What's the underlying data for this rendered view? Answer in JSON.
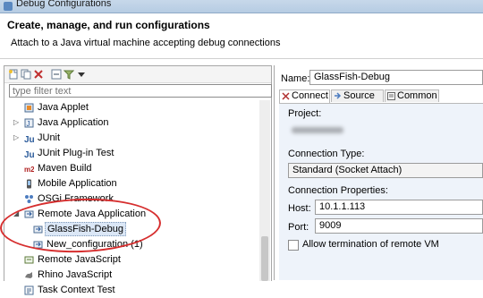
{
  "window": {
    "title": "Debug Configurations"
  },
  "header": {
    "title": "Create, manage, and run configurations",
    "subtitle": "Attach to a Java virtual machine accepting debug connections"
  },
  "left": {
    "filter_placeholder": "type filter text",
    "toolbar_icons": [
      "new-config-icon",
      "duplicate-icon",
      "delete-icon",
      "collapse-all-icon",
      "filter-icon",
      "dropdown-arrow-icon"
    ],
    "tree": [
      {
        "label": "Java Applet",
        "icon": "java-applet-icon",
        "level": 0,
        "expand": ""
      },
      {
        "label": "Java Application",
        "icon": "java-application-icon",
        "level": 0,
        "expand": "▷"
      },
      {
        "label": "JUnit",
        "icon": "junit-icon",
        "level": 0,
        "expand": "▷"
      },
      {
        "label": "JUnit Plug-in Test",
        "icon": "junit-plugin-icon",
        "level": 0,
        "expand": ""
      },
      {
        "label": "Maven Build",
        "icon": "maven-icon",
        "level": 0,
        "expand": ""
      },
      {
        "label": "Mobile Application",
        "icon": "mobile-icon",
        "level": 0,
        "expand": ""
      },
      {
        "label": "OSGi Framework",
        "icon": "osgi-icon",
        "level": 0,
        "expand": ""
      },
      {
        "label": "Remote Java Application",
        "icon": "remote-java-icon",
        "level": 0,
        "expand": "◢"
      },
      {
        "label": "GlassFish-Debug",
        "icon": "remote-java-icon",
        "level": 1,
        "expand": "",
        "selected": true
      },
      {
        "label": "New_configuration (1)",
        "icon": "remote-java-icon",
        "level": 1,
        "expand": ""
      },
      {
        "label": "Remote JavaScript",
        "icon": "remote-javascript-icon",
        "level": 0,
        "expand": ""
      },
      {
        "label": "Rhino JavaScript",
        "icon": "rhino-icon",
        "level": 0,
        "expand": ""
      },
      {
        "label": "Task Context Test",
        "icon": "task-context-icon",
        "level": 0,
        "expand": ""
      }
    ]
  },
  "right": {
    "name_label": "Name:",
    "name_value": "GlassFish-Debug",
    "tabs": [
      {
        "label": "Connect",
        "icon": "connect-icon",
        "active": true
      },
      {
        "label": "Source",
        "icon": "source-icon",
        "active": false
      },
      {
        "label": "Common",
        "icon": "common-icon",
        "active": false
      }
    ],
    "project_label": "Project:",
    "connection_type_label": "Connection Type:",
    "connection_type_value": "Standard (Socket Attach)",
    "connection_props_label": "Connection Properties:",
    "host_label": "Host:",
    "host_value": "10.1.1.113",
    "port_label": "Port:",
    "port_value": "9009",
    "allow_termination_label": "Allow termination of remote VM",
    "allow_termination_checked": false
  },
  "colors": {
    "annotation": "#d62e2e",
    "selection": "#dbe7f6",
    "panel_bg": "#eef3fa"
  }
}
